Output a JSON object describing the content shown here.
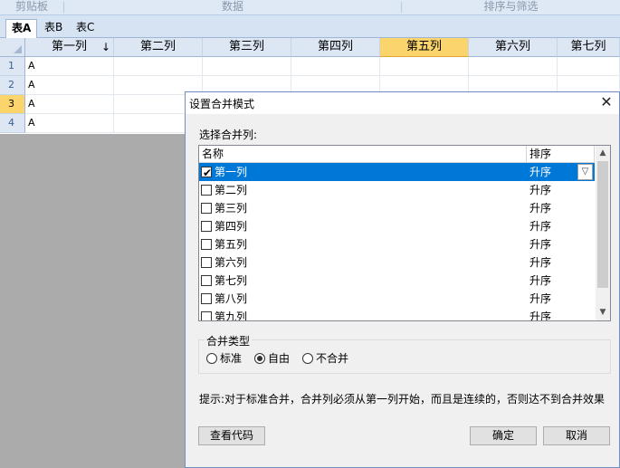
{
  "ribbon": {
    "groups": [
      "剪贴板",
      "数据",
      "排序与筛选"
    ]
  },
  "sheet_tabs": [
    "表A",
    "表B",
    "表C"
  ],
  "grid": {
    "columns": [
      "第一列",
      "第二列",
      "第三列",
      "第四列",
      "第五列",
      "第六列",
      "第七列"
    ],
    "sort_indicator": "↓",
    "rows": [
      "1",
      "2",
      "3",
      "4"
    ],
    "cells": [
      "A",
      "A",
      "A",
      "A"
    ]
  },
  "dialog": {
    "title": "设置合并模式",
    "close_glyph": "✕",
    "select_label": "选择合并列:",
    "list_headers": {
      "name": "名称",
      "sort": "排序"
    },
    "items": [
      {
        "name": "第一列",
        "sort": "升序",
        "checked": true
      },
      {
        "name": "第二列",
        "sort": "升序",
        "checked": false
      },
      {
        "name": "第三列",
        "sort": "升序",
        "checked": false
      },
      {
        "name": "第四列",
        "sort": "升序",
        "checked": false
      },
      {
        "name": "第五列",
        "sort": "升序",
        "checked": false
      },
      {
        "name": "第六列",
        "sort": "升序",
        "checked": false
      },
      {
        "name": "第七列",
        "sort": "升序",
        "checked": false
      },
      {
        "name": "第八列",
        "sort": "升序",
        "checked": false
      },
      {
        "name": "第九列",
        "sort": "升序",
        "checked": false
      }
    ],
    "merge_type": {
      "legend": "合并类型",
      "options": [
        "标准",
        "自由",
        "不合并"
      ],
      "selected": "自由"
    },
    "hint": "提示:对于标准合并，合并列必须从第一列开始，而且是连续的，否则达不到合并效果",
    "buttons": {
      "view_code": "查看代码",
      "ok": "确定",
      "cancel": "取消"
    }
  },
  "colors": {
    "selection": "#0078d7",
    "header_highlight": "#fbd46b",
    "header_bg": "#dde7f4"
  }
}
